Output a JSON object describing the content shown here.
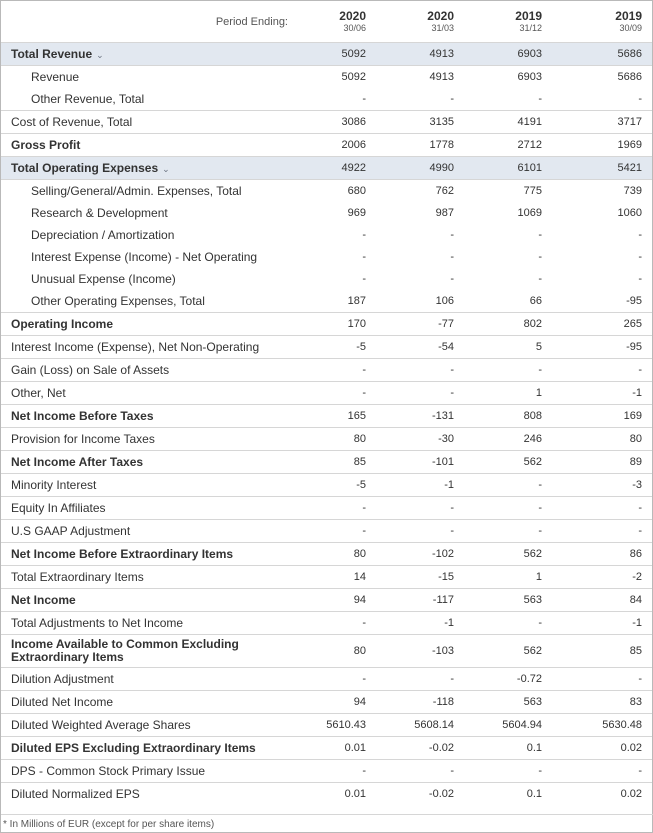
{
  "header": {
    "period_label": "Period Ending:",
    "columns": [
      {
        "year": "2020",
        "date": "30/06"
      },
      {
        "year": "2020",
        "date": "31/03"
      },
      {
        "year": "2019",
        "date": "31/12"
      },
      {
        "year": "2019",
        "date": "30/09"
      }
    ]
  },
  "rows": [
    {
      "label": "Total Revenue",
      "values": [
        "5092",
        "4913",
        "6903",
        "5686"
      ]
    },
    {
      "label": "Revenue",
      "values": [
        "5092",
        "4913",
        "6903",
        "5686"
      ]
    },
    {
      "label": "Other Revenue, Total",
      "values": [
        "-",
        "-",
        "-",
        "-"
      ]
    },
    {
      "label": "Cost of Revenue, Total",
      "values": [
        "3086",
        "3135",
        "4191",
        "3717"
      ]
    },
    {
      "label": "Gross Profit",
      "values": [
        "2006",
        "1778",
        "2712",
        "1969"
      ]
    },
    {
      "label": "Total Operating Expenses",
      "values": [
        "4922",
        "4990",
        "6101",
        "5421"
      ]
    },
    {
      "label": "Selling/General/Admin. Expenses, Total",
      "values": [
        "680",
        "762",
        "775",
        "739"
      ]
    },
    {
      "label": "Research & Development",
      "values": [
        "969",
        "987",
        "1069",
        "1060"
      ]
    },
    {
      "label": "Depreciation / Amortization",
      "values": [
        "-",
        "-",
        "-",
        "-"
      ]
    },
    {
      "label": "Interest Expense (Income) - Net Operating",
      "values": [
        "-",
        "-",
        "-",
        "-"
      ]
    },
    {
      "label": "Unusual Expense (Income)",
      "values": [
        "-",
        "-",
        "-",
        "-"
      ]
    },
    {
      "label": "Other Operating Expenses, Total",
      "values": [
        "187",
        "106",
        "66",
        "-95"
      ]
    },
    {
      "label": "Operating Income",
      "values": [
        "170",
        "-77",
        "802",
        "265"
      ]
    },
    {
      "label": "Interest Income (Expense), Net Non-Operating",
      "values": [
        "-5",
        "-54",
        "5",
        "-95"
      ]
    },
    {
      "label": "Gain (Loss) on Sale of Assets",
      "values": [
        "-",
        "-",
        "-",
        "-"
      ]
    },
    {
      "label": "Other, Net",
      "values": [
        "-",
        "-",
        "1",
        "-1"
      ]
    },
    {
      "label": "Net Income Before Taxes",
      "values": [
        "165",
        "-131",
        "808",
        "169"
      ]
    },
    {
      "label": "Provision for Income Taxes",
      "values": [
        "80",
        "-30",
        "246",
        "80"
      ]
    },
    {
      "label": "Net Income After Taxes",
      "values": [
        "85",
        "-101",
        "562",
        "89"
      ]
    },
    {
      "label": "Minority Interest",
      "values": [
        "-5",
        "-1",
        "-",
        "-3"
      ]
    },
    {
      "label": "Equity In Affiliates",
      "values": [
        "-",
        "-",
        "-",
        "-"
      ]
    },
    {
      "label": "U.S GAAP Adjustment",
      "values": [
        "-",
        "-",
        "-",
        "-"
      ]
    },
    {
      "label": "Net Income Before Extraordinary Items",
      "values": [
        "80",
        "-102",
        "562",
        "86"
      ]
    },
    {
      "label": "Total Extraordinary Items",
      "values": [
        "14",
        "-15",
        "1",
        "-2"
      ]
    },
    {
      "label": "Net Income",
      "values": [
        "94",
        "-117",
        "563",
        "84"
      ]
    },
    {
      "label": "Total Adjustments to Net Income",
      "values": [
        "-",
        "-1",
        "-",
        "-1"
      ]
    },
    {
      "label": "Income Available to Common Excluding Extraordinary Items",
      "values": [
        "80",
        "-103",
        "562",
        "85"
      ]
    },
    {
      "label": "Dilution Adjustment",
      "values": [
        "-",
        "-",
        "-0.72",
        "-"
      ]
    },
    {
      "label": "Diluted Net Income",
      "values": [
        "94",
        "-118",
        "563",
        "83"
      ]
    },
    {
      "label": "Diluted Weighted Average Shares",
      "values": [
        "5610.43",
        "5608.14",
        "5604.94",
        "5630.48"
      ]
    },
    {
      "label": "Diluted EPS Excluding Extraordinary Items",
      "values": [
        "0.01",
        "-0.02",
        "0.1",
        "0.02"
      ]
    },
    {
      "label": "DPS - Common Stock Primary Issue",
      "values": [
        "-",
        "-",
        "-",
        "-"
      ]
    },
    {
      "label": "Diluted Normalized EPS",
      "values": [
        "0.01",
        "-0.02",
        "0.1",
        "0.02"
      ]
    }
  ],
  "footnote": "* In Millions of EUR (except for per share items)",
  "colors": {
    "highlight_row": "#e2e8f0",
    "border": "#d6d6d6"
  },
  "icons": {
    "expand": "chevron-down-icon"
  }
}
